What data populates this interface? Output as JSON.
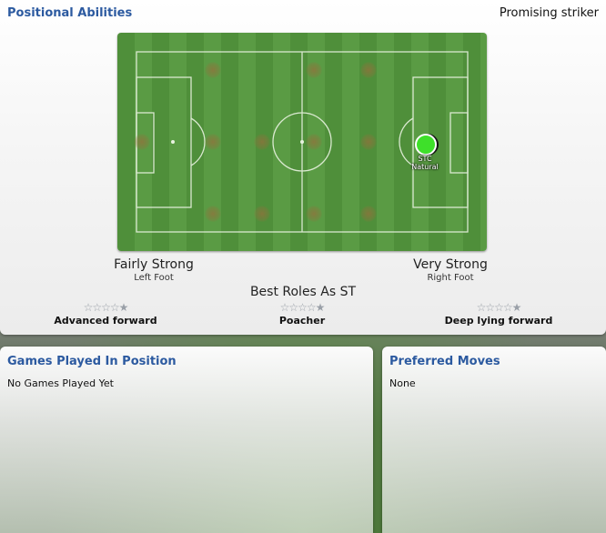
{
  "header": {
    "title": "Positional Abilities",
    "status": "Promising striker"
  },
  "pitch": {
    "player": {
      "position": "STC",
      "rating": "Natural",
      "dot_color": "#3ee02a"
    }
  },
  "feet": {
    "left": {
      "strength": "Fairly Strong",
      "label": "Left Foot"
    },
    "right": {
      "strength": "Very Strong",
      "label": "Right Foot"
    }
  },
  "best_roles": {
    "title": "Best Roles As ST",
    "roles": [
      {
        "name": "Advanced forward",
        "stars": "☆☆☆☆★"
      },
      {
        "name": "Poacher",
        "stars": "☆☆☆☆★"
      },
      {
        "name": "Deep lying forward",
        "stars": "☆☆☆☆★"
      }
    ]
  },
  "games_panel": {
    "title": "Games Played In Position",
    "body": "No Games Played Yet"
  },
  "moves_panel": {
    "title": "Preferred Moves",
    "body": "None"
  },
  "colors": {
    "accent": "#2c5aa0",
    "pitch_green": "#4f8f3a"
  }
}
